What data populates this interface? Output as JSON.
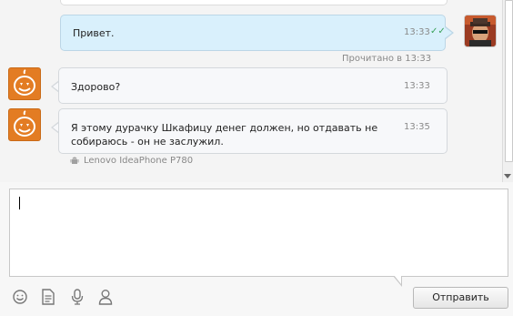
{
  "messages": [
    {
      "direction": "out",
      "text": "Привет.",
      "time": "13:33",
      "status": "Прочитано в 13:33"
    },
    {
      "direction": "in",
      "text": "Здорово?",
      "time": "13:33"
    },
    {
      "direction": "in",
      "text_line1": "Я этому дурачку Шкафицу денег должен, но отдавать не",
      "text_line2": "собираюсь - он не заслужил.",
      "time": "13:35",
      "device": "Lenovo IdeaPhone P780"
    }
  ],
  "composer": {
    "value": ""
  },
  "toolbar": {
    "icons": [
      "smiley-icon",
      "document-icon",
      "microphone-icon",
      "contact-icon"
    ],
    "send_label": "Отправить"
  },
  "colors": {
    "outgoing_bubble": "#d9f0fc",
    "incoming_bubble": "#f7f8fa",
    "pumpkin_avatar": "#e37c23",
    "read_check": "#3aa25a"
  }
}
